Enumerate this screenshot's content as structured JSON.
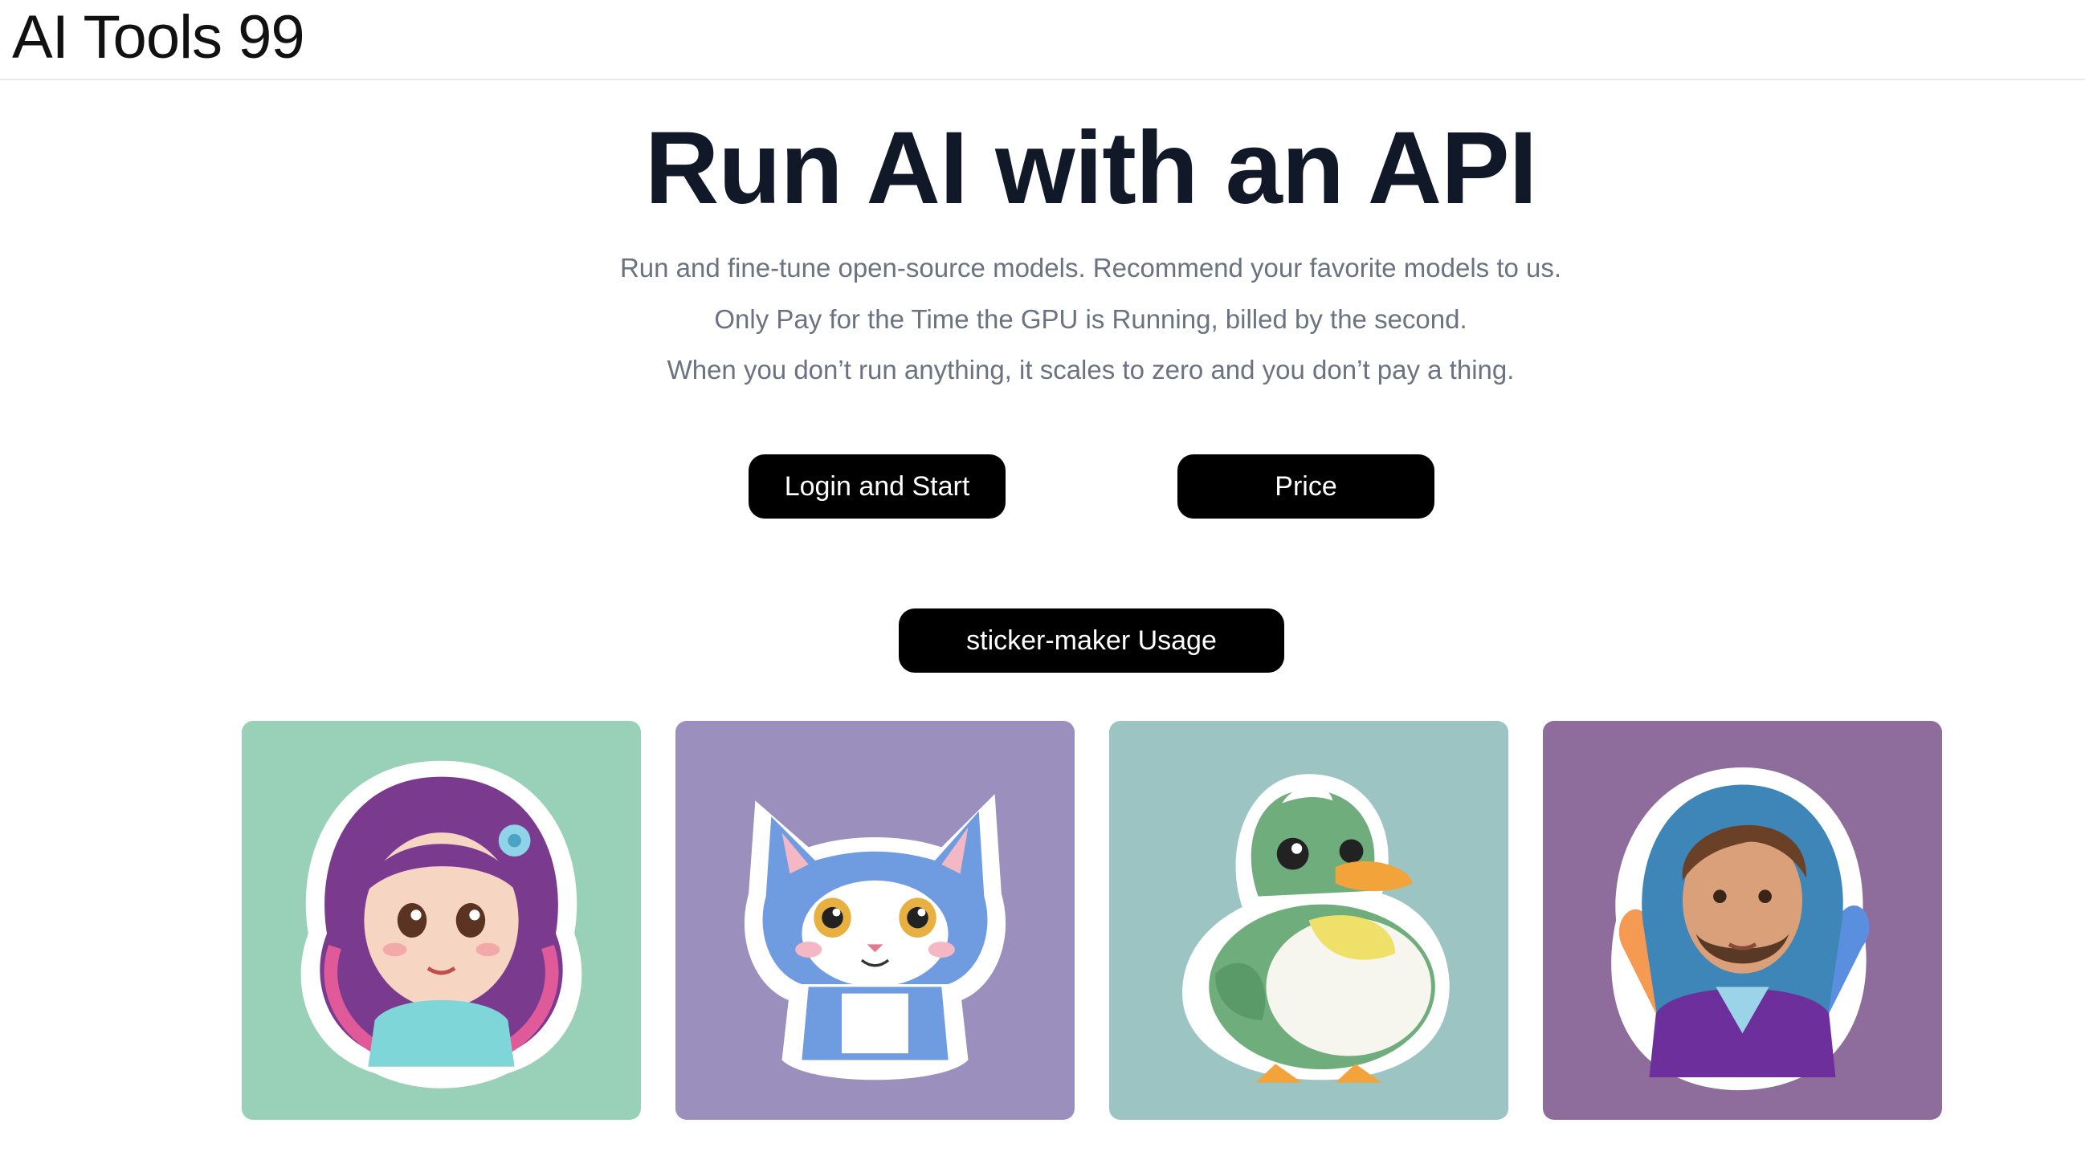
{
  "header": {
    "brand": "AI Tools 99"
  },
  "hero": {
    "title": "Run AI with an API",
    "lines": [
      "Run and fine-tune open-source models. Recommend your favorite models to us.",
      "Only Pay for the Time the GPU is Running, billed by the second.",
      "When you don’t run anything, it scales to zero and you don’t pay a thing."
    ]
  },
  "buttons": {
    "login": "Login and Start",
    "price": "Price",
    "usage": "sticker-maker Usage"
  },
  "gallery": [
    {
      "icon": "girl-sticker-icon",
      "bg": "#98d0b8"
    },
    {
      "icon": "kitten-sticker-icon",
      "bg": "#9b8fbd"
    },
    {
      "icon": "duck-sticker-icon",
      "bg": "#9cc4c2"
    },
    {
      "icon": "man-sticker-icon",
      "bg": "#8e6d9c"
    }
  ],
  "colors": {
    "title": "#111827",
    "subtext": "#6b7280",
    "button_bg": "#000000",
    "button_text": "#ffffff"
  }
}
